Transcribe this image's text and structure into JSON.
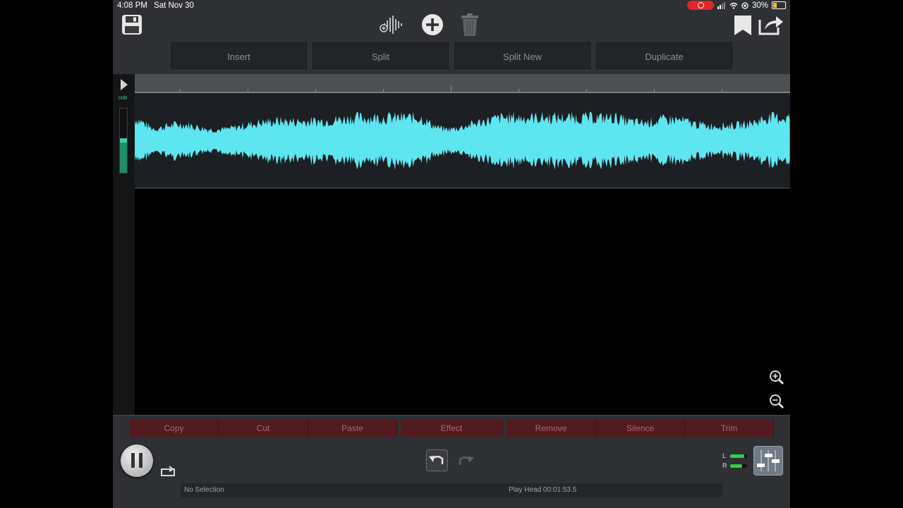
{
  "status_bar": {
    "time": "4:08 PM",
    "date": "Sat Nov 30",
    "battery": "30%",
    "battery_fraction": 0.3
  },
  "toolbar": {
    "icons": [
      "save-icon",
      "add-waveform-icon",
      "add-icon",
      "trash-icon",
      "bookmark-icon",
      "share-icon"
    ]
  },
  "segments": [
    "Insert",
    "Split",
    "Split New",
    "Duplicate"
  ],
  "track": {
    "meter_label": "0dB",
    "wave_color": "#5ee6f0"
  },
  "edit_actions": [
    "Copy",
    "Cut",
    "Paste",
    "Effect",
    "Remove",
    "Silence",
    "Trim"
  ],
  "meters": {
    "left_label": "L",
    "right_label": "R",
    "left_level": 0.85,
    "right_level": 0.7
  },
  "status": {
    "selection": "No Selection",
    "playhead": "Play Head 00:01:53.5"
  },
  "colors": {
    "accent": "#5ee6f0",
    "edit_button_bg": "#521a1f",
    "meter_green": "#2fd04a"
  }
}
